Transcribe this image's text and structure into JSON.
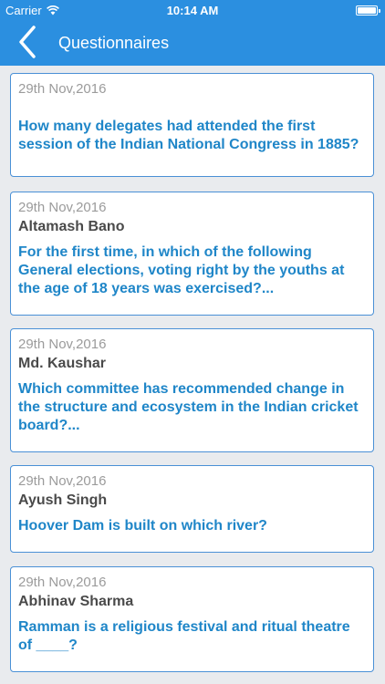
{
  "statusbar": {
    "carrier": "Carrier",
    "time": "10:14 AM",
    "wifi_icon": "wifi-icon",
    "battery_icon": "battery-icon",
    "battery_level": 1.0
  },
  "navbar": {
    "title": "Questionnaires",
    "back_icon": "chevron-left-icon",
    "color": "#2b8fe0"
  },
  "items": [
    {
      "date": "29th Nov,2016",
      "author": "",
      "question": "How many delegates had attended the first session of the Indian National Congress in 1885?"
    },
    {
      "date": "29th Nov,2016",
      "author": "Altamash Bano",
      "question": "For the first time, in which of the following General elections, voting right by the youths at the age of 18 years was exercised?..."
    },
    {
      "date": "29th Nov,2016",
      "author": "Md. Kaushar",
      "question": "Which committee has recommended change in the structure and ecosystem in the Indian cricket board?..."
    },
    {
      "date": "29th Nov,2016",
      "author": "Ayush Singh",
      "question": "Hoover Dam is built on which river?"
    },
    {
      "date": "29th Nov,2016",
      "author": "Abhinav Sharma",
      "question": "Ramman is a religious festival and ritual theatre of ____?"
    }
  ],
  "colors": {
    "accent": "#2b8fe0",
    "question_text": "#1f86c8",
    "card_border": "#4a90d6",
    "background": "#e9ebee"
  }
}
